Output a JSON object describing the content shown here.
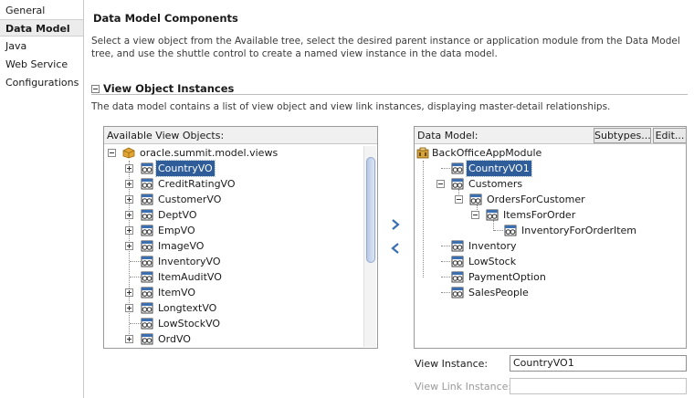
{
  "nav": {
    "items": [
      "General",
      "Data Model",
      "Java",
      "Web Service",
      "Configurations"
    ],
    "selected_index": 1
  },
  "header": {
    "title": "Data Model Components",
    "description": "Select a view object from the Available tree, select the desired parent instance or application module from the Data Model tree, and use the shuttle control to create a named view instance in the data model."
  },
  "section": {
    "title": "View Object Instances",
    "description": "The data model contains a list of view object and view link instances, displaying master-detail relationships."
  },
  "available": {
    "header": "Available View Objects:",
    "root": "oracle.summit.model.views",
    "items": [
      {
        "label": "CountryVO",
        "expandable": true,
        "selected": true
      },
      {
        "label": "CreditRatingVO",
        "expandable": true,
        "selected": false
      },
      {
        "label": "CustomerVO",
        "expandable": true,
        "selected": false
      },
      {
        "label": "DeptVO",
        "expandable": true,
        "selected": false
      },
      {
        "label": "EmpVO",
        "expandable": true,
        "selected": false
      },
      {
        "label": "ImageVO",
        "expandable": true,
        "selected": false
      },
      {
        "label": "InventoryVO",
        "expandable": false,
        "selected": false
      },
      {
        "label": "ItemAuditVO",
        "expandable": false,
        "selected": false
      },
      {
        "label": "ItemVO",
        "expandable": true,
        "selected": false
      },
      {
        "label": "LongtextVO",
        "expandable": true,
        "selected": false
      },
      {
        "label": "LowStockVO",
        "expandable": false,
        "selected": false
      },
      {
        "label": "OrdVO",
        "expandable": true,
        "selected": false
      }
    ]
  },
  "datamodel": {
    "header": "Data Model:",
    "subtypes_label": "Subtypes...",
    "edit_label": "Edit...",
    "root": "BackOfficeAppModule",
    "items": [
      {
        "label": "CountryVO1",
        "level": 1,
        "selected": true
      },
      {
        "label": "Customers",
        "level": 1,
        "selected": false
      },
      {
        "label": "OrdersForCustomer",
        "level": 2,
        "selected": false
      },
      {
        "label": "ItemsForOrder",
        "level": 3,
        "selected": false
      },
      {
        "label": "InventoryForOrderItem",
        "level": 4,
        "selected": false
      },
      {
        "label": "Inventory",
        "level": 1,
        "selected": false
      },
      {
        "label": "LowStock",
        "level": 1,
        "selected": false
      },
      {
        "label": "PaymentOption",
        "level": 1,
        "selected": false
      },
      {
        "label": "SalesPeople",
        "level": 1,
        "selected": false
      }
    ]
  },
  "shuttle": {
    "add_icon": "chevron-right-icon",
    "remove_icon": "chevron-left-icon"
  },
  "fields": {
    "view_instance_label": "View Instance:",
    "view_instance_value": "CountryVO1",
    "view_link_instance_label": "View Link Instance:",
    "view_link_instance_value": ""
  },
  "colors": {
    "selection": "#2f5d9a",
    "icon_blue": "#3b6fb0",
    "icon_gold": "#c9921c"
  }
}
